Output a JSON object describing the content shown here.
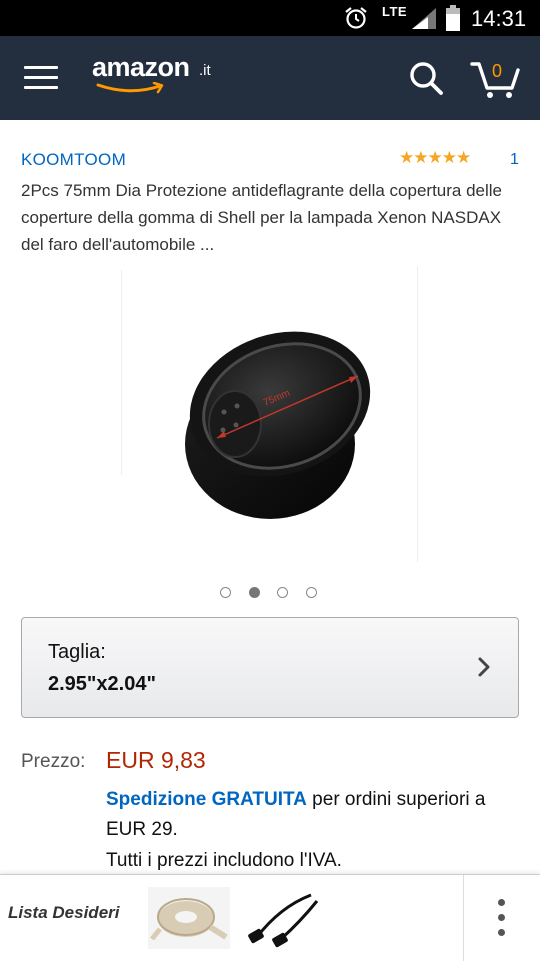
{
  "status_bar": {
    "network": "LTE",
    "time": "14:31"
  },
  "header": {
    "logo_word": "amazon",
    "logo_tld": ".it",
    "cart_count": "0"
  },
  "product": {
    "brand": "KOOMTOOM",
    "rating_stars": "★★★★★",
    "rating_value": 5,
    "rating_count": "1",
    "title": "2Pcs 75mm Dia Protezione antideflagrante della copertura delle coperture della gomma di Shell per la lampada Xenon NASDAX del faro dell'automobile ...",
    "image_label": "75mm",
    "gallery_total": 4,
    "gallery_active": 2
  },
  "size": {
    "label": "Taglia:",
    "value": "2.95\"x2.04\""
  },
  "price": {
    "label": "Prezzo:",
    "value": "EUR 9,83",
    "shipping_free": "Spedizione GRATUITA",
    "shipping_rest": " per ordini superiori a EUR 29.",
    "vat_note": "Tutti i prezzi includono l'IVA."
  },
  "bottom_bar": {
    "wishlist_label": "Lista Desideri"
  },
  "colors": {
    "header_bg": "#232f3e",
    "link_blue": "#0066c0",
    "price_red": "#b12704",
    "star_orange": "#f5a623",
    "cart_orange": "#ff9900"
  }
}
